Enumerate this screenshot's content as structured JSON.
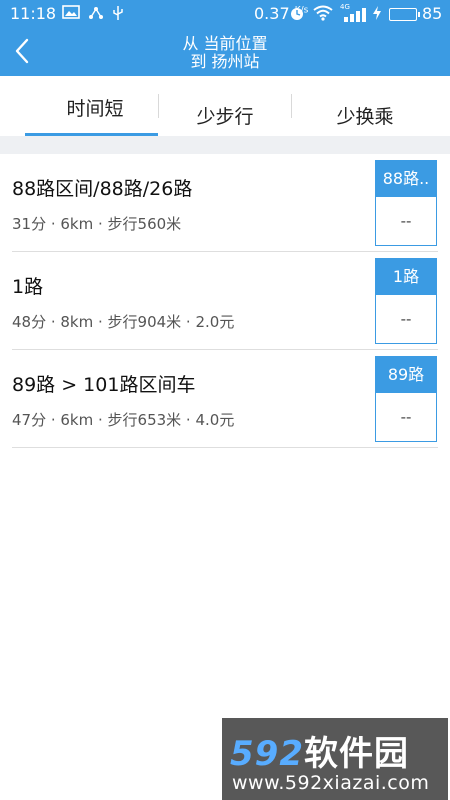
{
  "status_bar": {
    "time": "11:18",
    "net_speed": "0.37",
    "net_speed_unit": "K/s",
    "network_type": "4G",
    "battery_level": "85",
    "battery_fraction": 0.85
  },
  "nav": {
    "title_line1": "从 当前位置",
    "title_line2": "到 扬州站"
  },
  "tabs": [
    {
      "label": "时间短",
      "selected": true
    },
    {
      "label": "少步行",
      "selected": false
    },
    {
      "label": "少换乘",
      "selected": false
    }
  ],
  "routes": [
    {
      "name": "88路区间/88路/26路",
      "meta": "31分 · 6km · 步行560米",
      "badge": "88路..",
      "badge_value": "--"
    },
    {
      "name": "1路",
      "meta": "48分 · 8km · 步行904米 · 2.0元",
      "badge": "1路",
      "badge_value": "--"
    },
    {
      "name": "89路 > 101路区间车",
      "meta": "47分 · 6km · 步行653米 · 4.0元",
      "badge": "89路",
      "badge_value": "--"
    }
  ],
  "watermark": {
    "brand_digits": "592",
    "brand_text": "软件园",
    "url": "www.592xiazai.com"
  },
  "colors": {
    "accent": "#3b9be3",
    "battery": "#3ee35a"
  }
}
